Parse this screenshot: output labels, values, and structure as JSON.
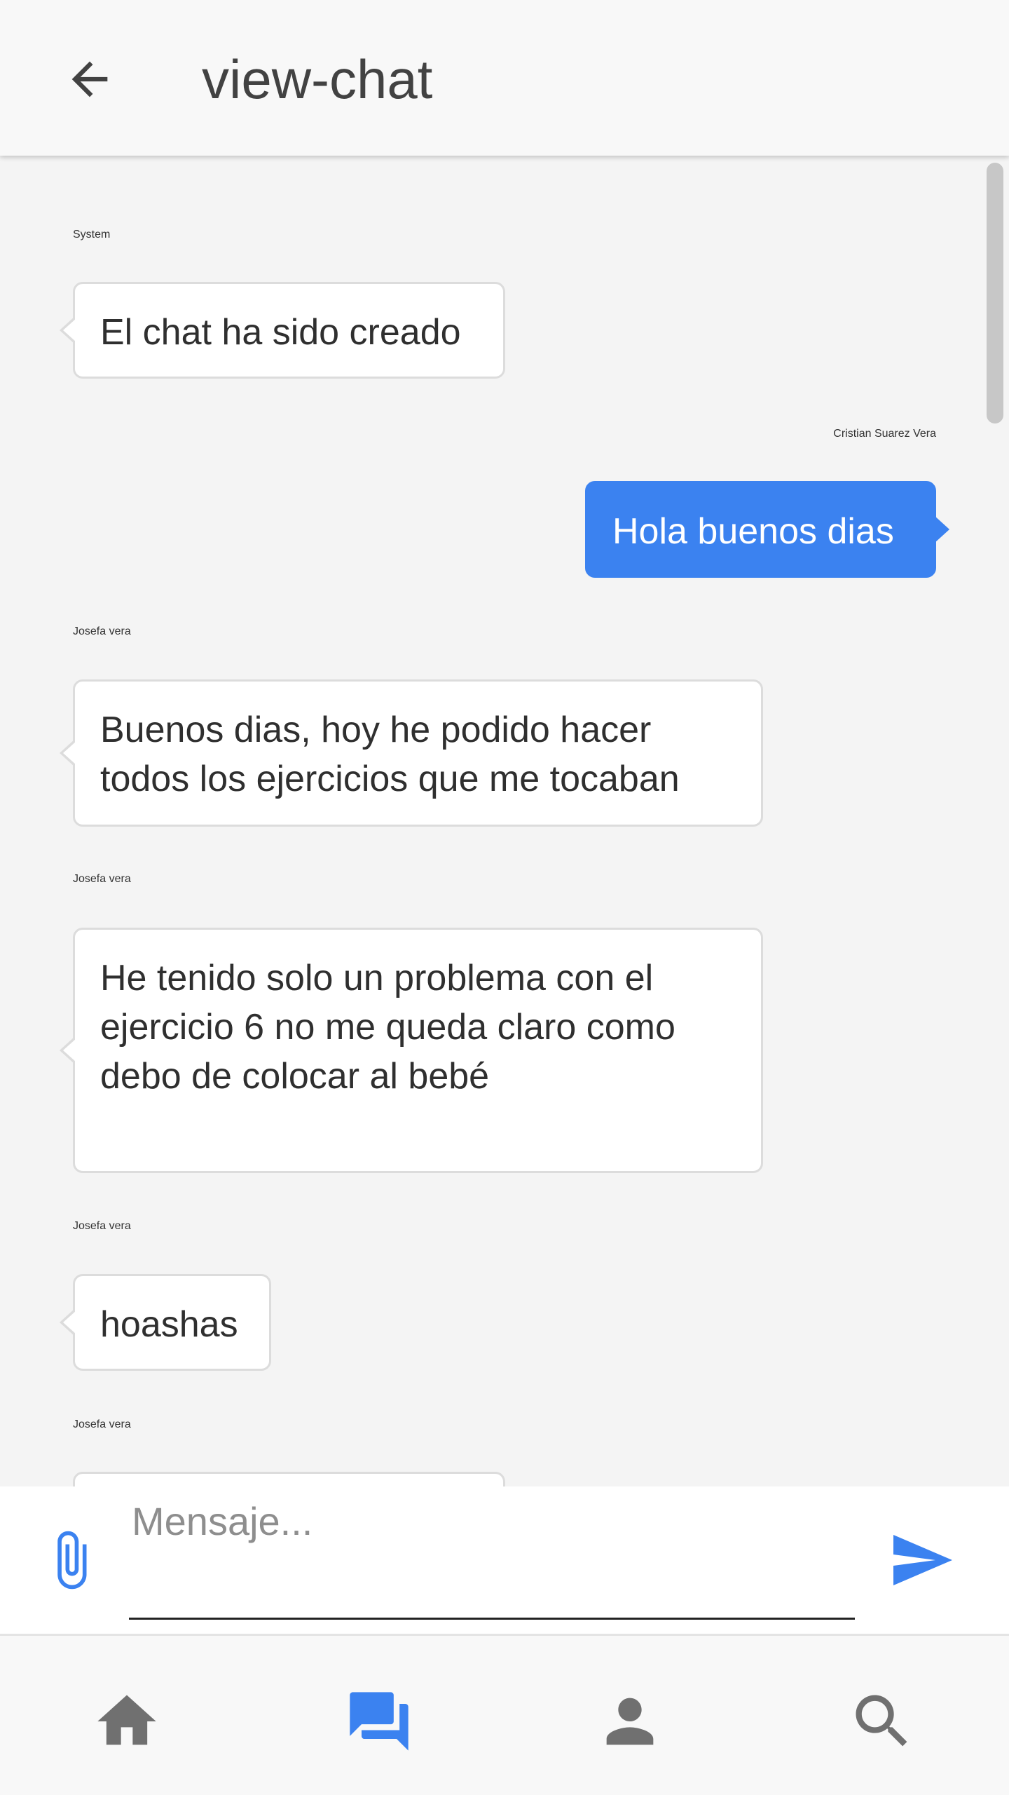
{
  "header": {
    "title": "view-chat",
    "back_icon": "arrow-back-icon"
  },
  "messages": [
    {
      "sender": "System",
      "text": "El chat ha sido creado",
      "direction": "incoming"
    },
    {
      "sender": "Cristian Suarez Vera",
      "text": "Hola buenos dias",
      "direction": "outgoing"
    },
    {
      "sender": "Josefa vera",
      "text": "Buenos dias, hoy he podido hacer todos los ejercicios que me tocaban",
      "direction": "incoming"
    },
    {
      "sender": "Josefa vera",
      "text": "He tenido solo un problema con el ejercicio 6 no me queda claro como debo de colocar al bebé",
      "direction": "incoming"
    },
    {
      "sender": "Josefa vera",
      "text": "hoashas",
      "direction": "incoming"
    },
    {
      "sender": "Josefa vera",
      "text": "",
      "direction": "incoming"
    }
  ],
  "composer": {
    "placeholder": "Mensaje...",
    "value": "",
    "attach_icon": "paperclip-icon",
    "send_icon": "send-icon"
  },
  "tabs": [
    {
      "name": "home",
      "icon": "home-icon",
      "active": false
    },
    {
      "name": "chats",
      "icon": "chat-icon",
      "active": true
    },
    {
      "name": "profile",
      "icon": "person-icon",
      "active": false
    },
    {
      "name": "search",
      "icon": "search-icon",
      "active": false
    }
  ],
  "colors": {
    "accent": "#3b82f0",
    "icon_inactive": "#707070",
    "background": "#f4f4f4",
    "bubble_in": "#ffffff",
    "bubble_out": "#3b82f0"
  }
}
